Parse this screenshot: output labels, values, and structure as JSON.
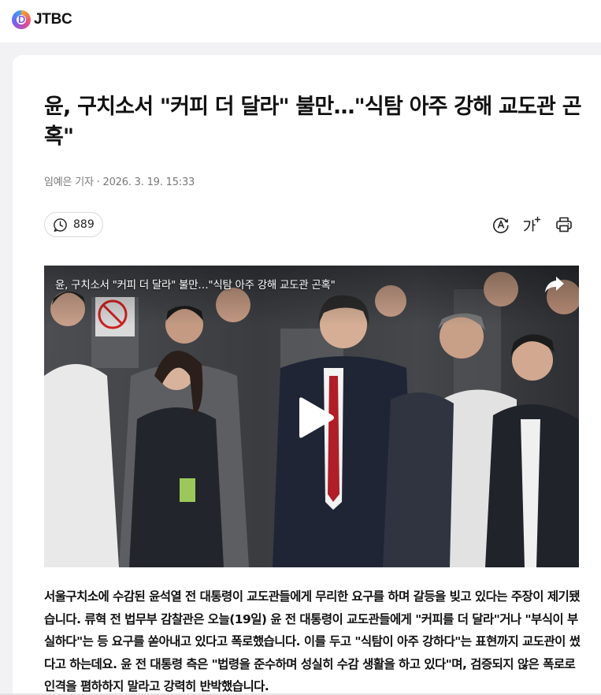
{
  "header": {
    "logo_letter": "D",
    "brand": "JTBC"
  },
  "article": {
    "headline": "윤, 구치소서 \"커피 더 달라\" 불만…\"식탐 아주 강해 교도관 곤혹\"",
    "byline": "임예은 기자 · 2026. 3. 19. 15:33",
    "comment_count": "889",
    "tools": [
      "translate-icon",
      "font-size-icon",
      "print-icon"
    ],
    "video": {
      "title": "윤, 구치소서 \"커피 더 달라\" 불만…\"식탐 아주 강해 교도관 곤혹\"",
      "share_icon": "share-arrow-icon",
      "play_icon": "play-icon"
    },
    "body": "서울구치소에 수감된 윤석열 전 대통령이 교도관들에게 무리한 요구를 하며 갈등을 빚고 있다는 주장이 제기됐습니다. 류혁 전 법무부 감찰관은 오늘(19일) 윤 전 대통령이 교도관들에게 \"커피를 더 달라\"거나 \"부식이 부실하다\"는 등 요구를 쏟아내고 있다고 폭로했습니다. 이를 두고 \"식탐이 아주 강하다\"는 표현까지 교도관이 썼다고 하는데요. 윤 전 대통령 측은 \"법령을 준수하며 성실히 수감 생활을 하고 있다\"며, 검증되지 않은 폭로로 인격을 폄하하지 말라고 강력히 반박했습니다."
  },
  "colors": {
    "accent_purple": "#7b5cf0",
    "background": "#f2f2f4",
    "tie_red": "#b01e28"
  }
}
